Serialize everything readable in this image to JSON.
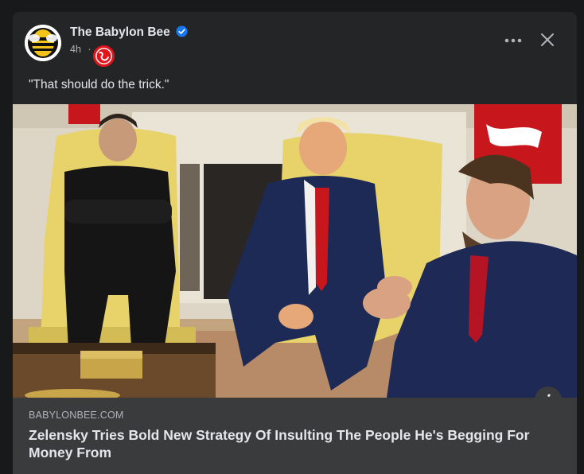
{
  "post": {
    "page_name": "The Babylon Bee",
    "time": "4h",
    "separator": "·",
    "caption": "\"That should do the trick.\""
  },
  "link": {
    "domain": "BABYLONBEE.COM",
    "headline": "Zelensky Tries Bold New Strategy Of Insulting The People He's Begging For Money From"
  },
  "photo": {
    "description_icons": [
      "yellow-armchair",
      "fireplace",
      "red-flag"
    ]
  },
  "icons": {
    "avatar": "babylon-bee-logo-icon",
    "verified": "verified-badge-icon",
    "audience": "globe-icon",
    "more": "more-options-icon",
    "close": "close-icon",
    "info": "info-icon"
  },
  "colors": {
    "background": "#18191a",
    "card": "#242526",
    "footer": "#3a3b3c",
    "verified": "#1877f2",
    "flag": "#c8161d",
    "chair": "#e8d26a"
  }
}
